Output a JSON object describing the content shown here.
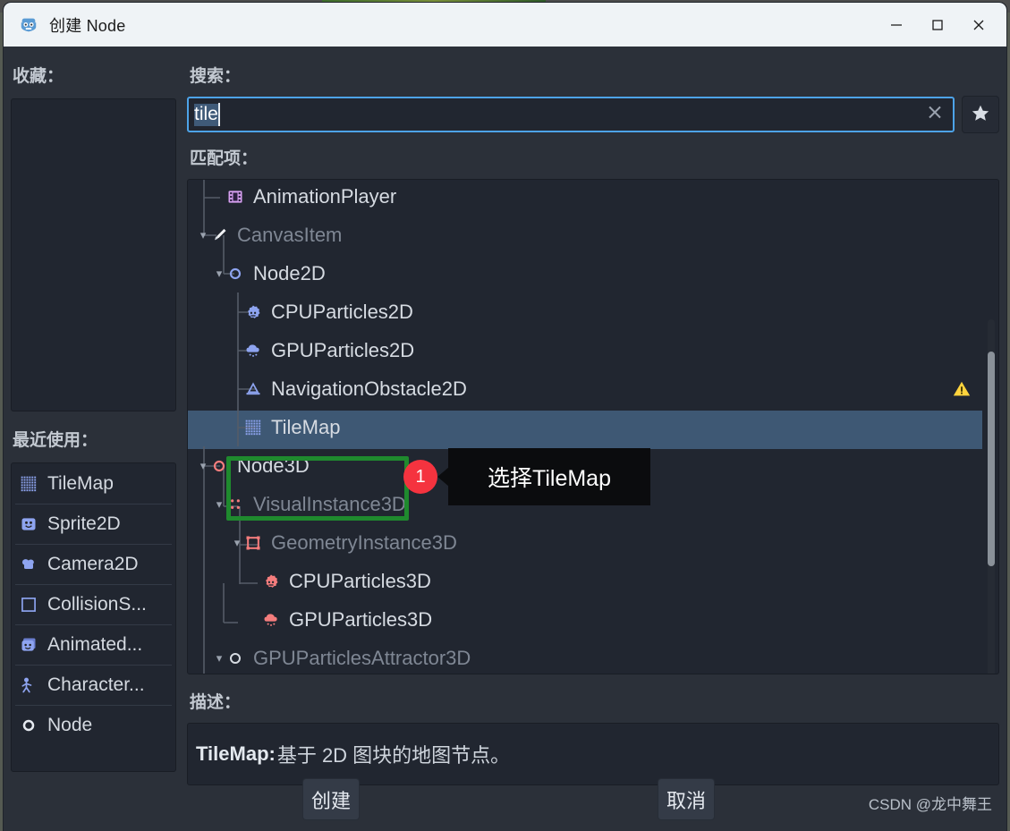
{
  "window": {
    "title": "创建 Node",
    "app_icon": "godot-icon",
    "controls": {
      "minimize": "minimize-icon",
      "maximize": "maximize-icon",
      "close": "close-icon"
    }
  },
  "favorites": {
    "label": "收藏：",
    "items": []
  },
  "recent": {
    "label": "最近使用：",
    "items": [
      {
        "label": "TileMap",
        "icon": "tilemap-icon",
        "color": "#8ea4f0"
      },
      {
        "label": "Sprite2D",
        "icon": "sprite2d-icon",
        "color": "#8ea4f0"
      },
      {
        "label": "Camera2D",
        "icon": "camera2d-icon",
        "color": "#8ea4f0"
      },
      {
        "label": "CollisionS...",
        "icon": "collisionshape2d-icon",
        "color": "#8ea4f0"
      },
      {
        "label": "Animated...",
        "icon": "animatedsprite2d-icon",
        "color": "#8ea4f0"
      },
      {
        "label": "Character...",
        "icon": "characterbody2d-icon",
        "color": "#8ea4f0"
      },
      {
        "label": "Node",
        "icon": "node-icon",
        "color": "#e6eaf0"
      }
    ]
  },
  "search": {
    "label": "搜索：",
    "value": "tile",
    "placeholder": "",
    "clear_icon": "close-icon",
    "favorite_icon": "star-icon"
  },
  "matches": {
    "label": "匹配项：",
    "items": [
      {
        "label": "AnimationPlayer",
        "state": "normal",
        "icon": "animationplayer-icon",
        "indent": 1,
        "expander": "none",
        "warning": false
      },
      {
        "label": "CanvasItem",
        "state": "disabled",
        "icon": "canvasitem-icon",
        "indent": 0,
        "expander": "expanded",
        "warning": false
      },
      {
        "label": "Node2D",
        "state": "normal",
        "icon": "node2d-icon",
        "indent": 1,
        "expander": "expanded",
        "warning": false
      },
      {
        "label": "CPUParticles2D",
        "state": "normal",
        "icon": "cpuparticles2d-icon",
        "indent": 2,
        "expander": "none",
        "warning": false
      },
      {
        "label": "GPUParticles2D",
        "state": "normal",
        "icon": "gpuparticles2d-icon",
        "indent": 2,
        "expander": "none",
        "warning": false
      },
      {
        "label": "NavigationObstacle2D",
        "state": "normal",
        "icon": "navobstacle2d-icon",
        "indent": 2,
        "expander": "none",
        "warning": true
      },
      {
        "label": "TileMap",
        "state": "selected",
        "icon": "tilemap-icon",
        "indent": 2,
        "expander": "none",
        "warning": false
      },
      {
        "label": "Node3D",
        "state": "normal",
        "icon": "node3d-icon",
        "indent": 0,
        "expander": "expanded",
        "warning": false
      },
      {
        "label": "VisualInstance3D",
        "state": "disabled",
        "icon": "visualinstance3d-icon",
        "indent": 1,
        "expander": "expanded",
        "warning": false
      },
      {
        "label": "GeometryInstance3D",
        "state": "disabled",
        "icon": "geometryinstance3d-icon",
        "indent": 2,
        "expander": "expanded",
        "warning": false
      },
      {
        "label": "CPUParticles3D",
        "state": "normal",
        "icon": "cpuparticles3d-icon",
        "indent": 3,
        "expander": "none",
        "warning": false
      },
      {
        "label": "GPUParticles3D",
        "state": "normal",
        "icon": "gpuparticles3d-icon",
        "indent": 3,
        "expander": "none",
        "warning": false
      },
      {
        "label": "GPUParticlesAttractor3D",
        "state": "disabled",
        "icon": "gpuattractor3d-icon",
        "indent": 1,
        "expander": "expanded",
        "warning": false
      }
    ],
    "warning_icon": "warning-triangle-icon"
  },
  "callout": {
    "badge": "1",
    "text": "选择TileMap"
  },
  "description": {
    "label": "描述：",
    "title": "TileMap:",
    "text": "基于 2D 图块的地图节点。"
  },
  "footer": {
    "create": "创建",
    "cancel": "取消",
    "watermark": "CSDN @龙中舞王"
  },
  "colors": {
    "accent_blue": "#4da3e8",
    "selection_blue": "#3e5874",
    "highlight_green": "#1f8a2e",
    "badge_red": "#f5333f",
    "warning_yellow": "#ffd33d",
    "panel_bg": "#212630",
    "dialog_bg": "#2b3039"
  }
}
